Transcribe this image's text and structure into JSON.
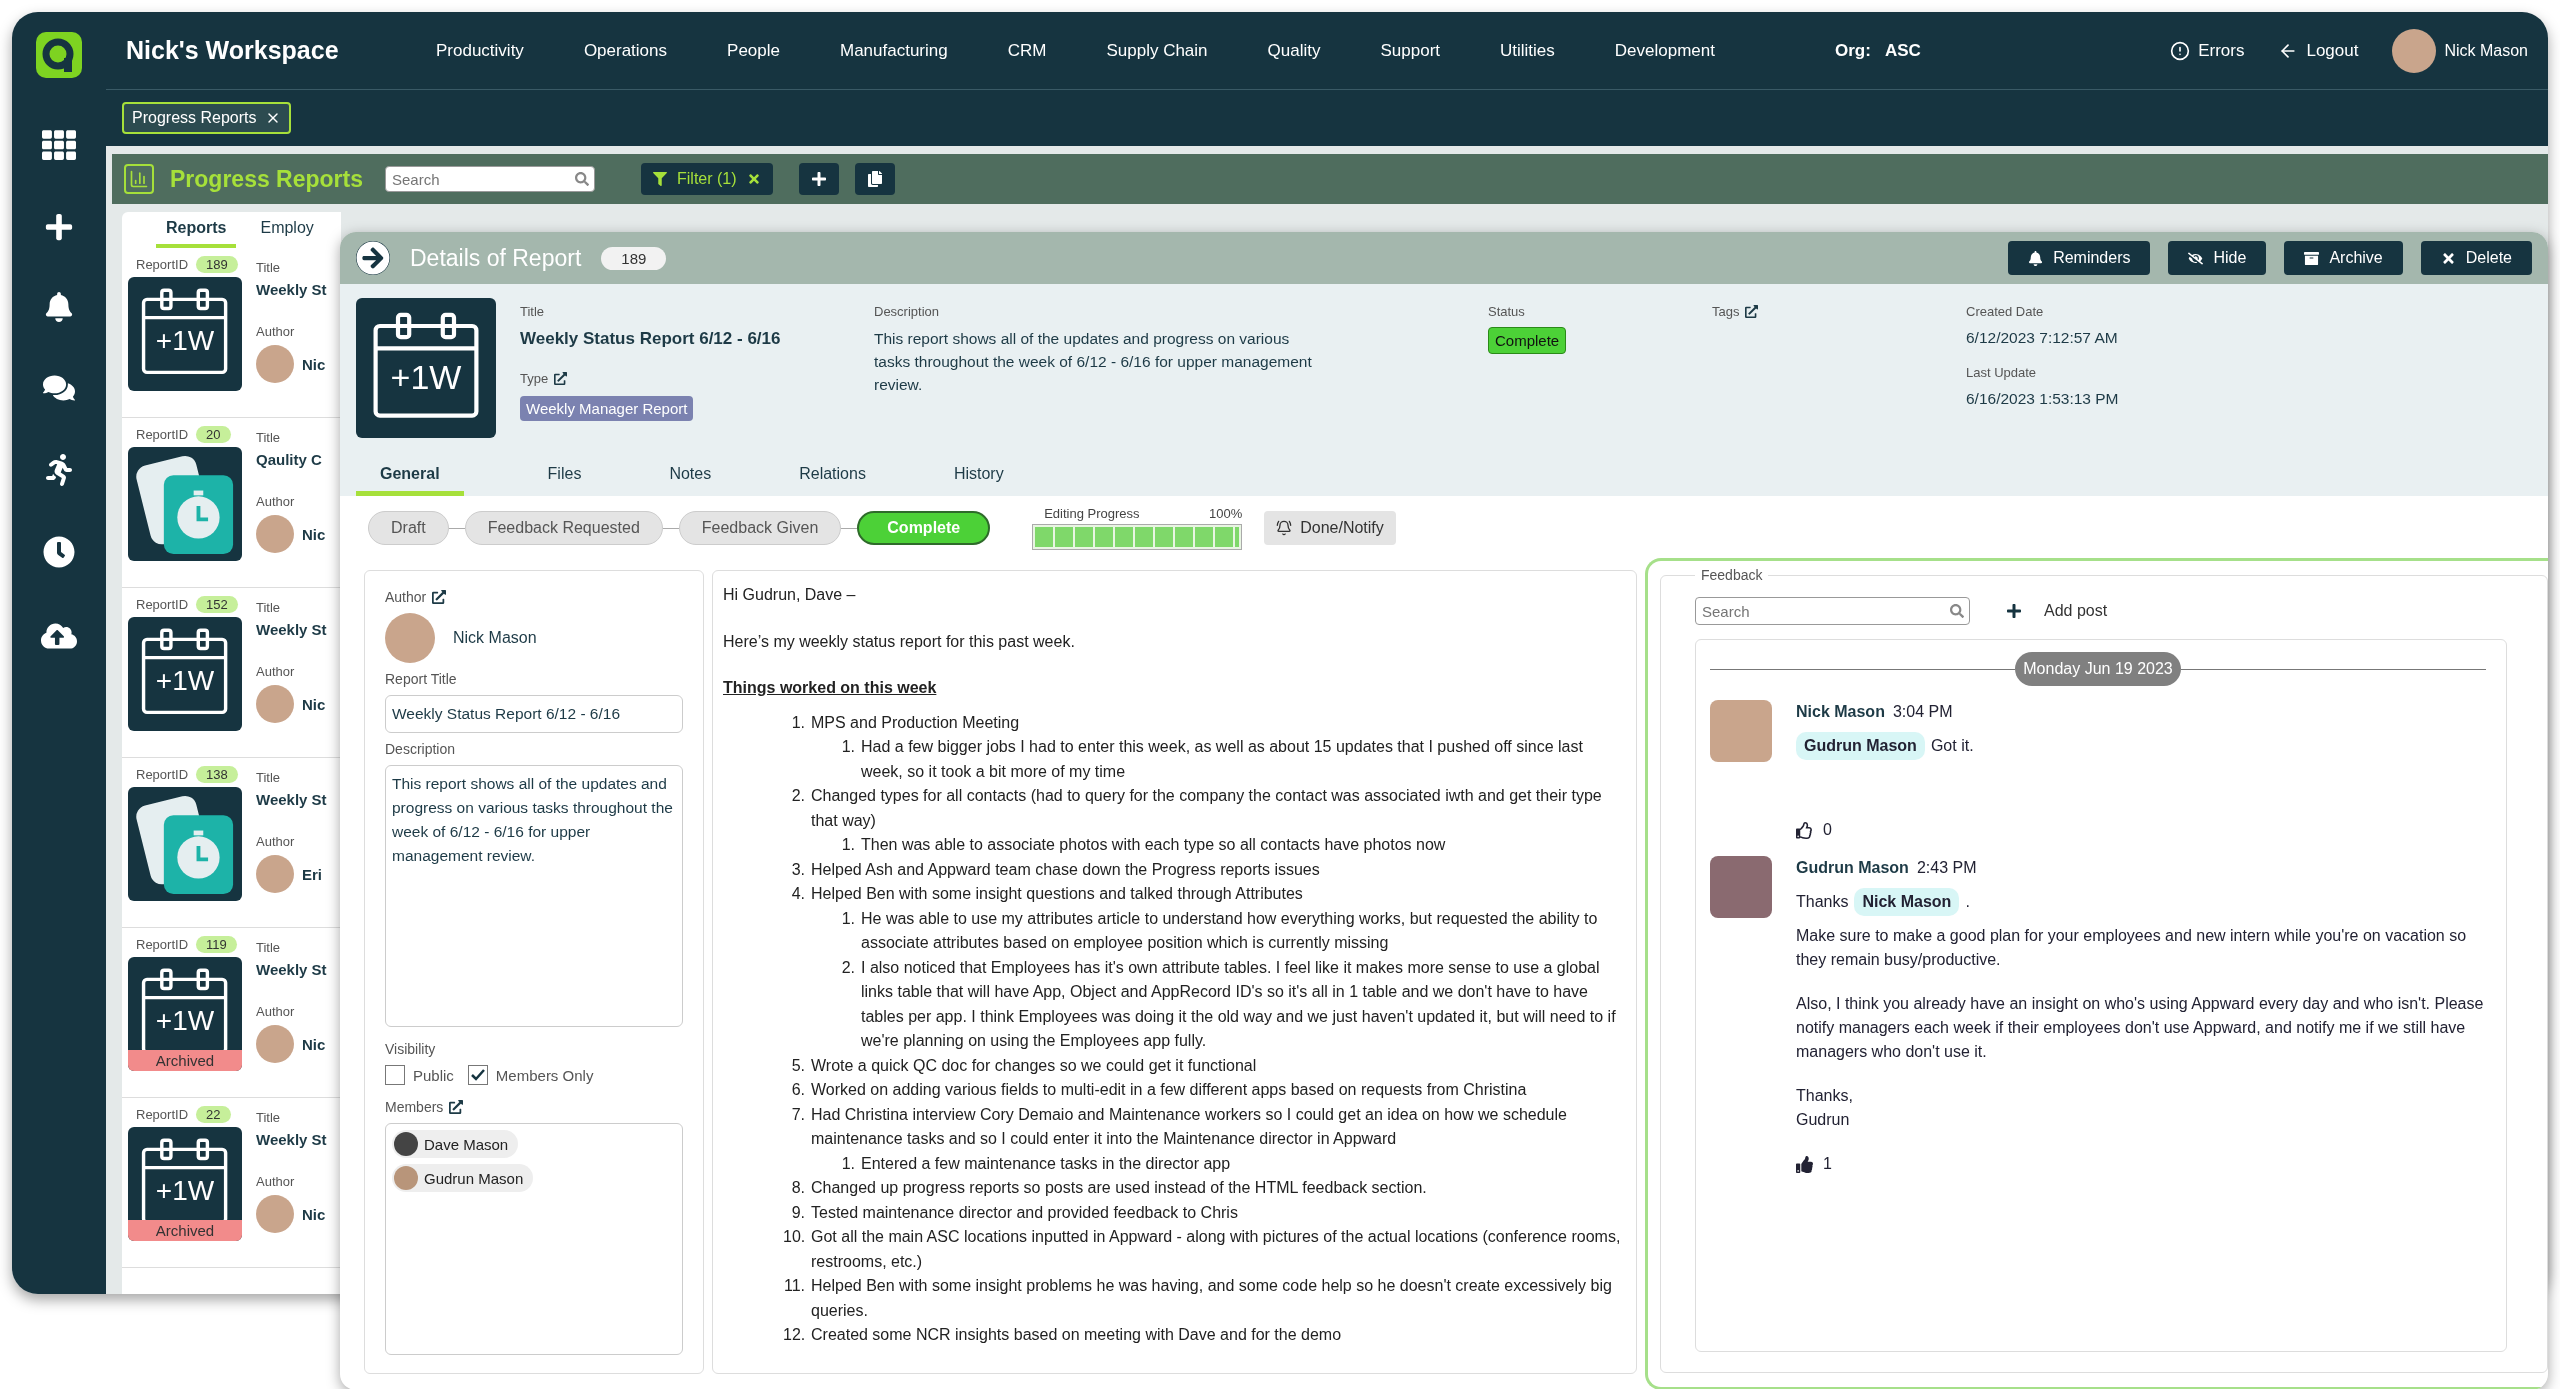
{
  "app": {
    "workspace": "Nick's Workspace",
    "nav": [
      "Productivity",
      "Operations",
      "People",
      "Manufacturing",
      "CRM",
      "Supply Chain",
      "Quality",
      "Support",
      "Utilities",
      "Development"
    ],
    "org_label": "Org:",
    "org": "ASC",
    "errors": "Errors",
    "logout": "Logout",
    "user": "Nick Mason"
  },
  "open_tabs": [
    {
      "label": "Progress Reports"
    }
  ],
  "toolbar": {
    "title": "Progress Reports",
    "search_placeholder": "Search",
    "filter": "Filter (1)"
  },
  "list": {
    "tabs": [
      {
        "label": "Reports",
        "selected": true
      },
      {
        "label": "Employ",
        "selected": false
      }
    ],
    "cards": [
      {
        "id_label": "ReportID",
        "id": "189",
        "title_label": "Title",
        "title": "Weekly St",
        "author_label": "Author",
        "author": "Nic",
        "kind": "calendar",
        "badge": "+1W"
      },
      {
        "id_label": "ReportID",
        "id": "20",
        "title_label": "Title",
        "title": "Qaulity C",
        "author_label": "Author",
        "author": "Nic",
        "kind": "timer"
      },
      {
        "id_label": "ReportID",
        "id": "152",
        "title_label": "Title",
        "title": "Weekly St",
        "author_label": "Author",
        "author": "Nic",
        "kind": "calendar",
        "badge": "+1W"
      },
      {
        "id_label": "ReportID",
        "id": "138",
        "title_label": "Title",
        "title": "Weekly St",
        "author_label": "Author",
        "author": "Eri",
        "kind": "timer"
      },
      {
        "id_label": "ReportID",
        "id": "119",
        "title_label": "Title",
        "title": "Weekly St",
        "author_label": "Author",
        "author": "Nic",
        "kind": "calendar",
        "badge": "+1W",
        "ribbon": "Archived"
      },
      {
        "id_label": "ReportID",
        "id": "22",
        "title_label": "Title",
        "title": "Weekly St",
        "author_label": "Author",
        "author": "Nic",
        "kind": "calendar",
        "badge": "+1W",
        "ribbon": "Archived"
      }
    ]
  },
  "detail": {
    "title": "Details of Report",
    "count": "189",
    "actions": [
      {
        "kind": "reminders",
        "label": "Reminders"
      },
      {
        "kind": "hide",
        "label": "Hide"
      },
      {
        "kind": "archive",
        "label": "Archive"
      },
      {
        "kind": "delete",
        "label": "Delete"
      }
    ],
    "badge": "+1W",
    "title_label": "Title",
    "title_value": "Weekly Status Report 6/12 - 6/16",
    "type_label": "Type",
    "type_value": "Weekly Manager Report",
    "description_label": "Description",
    "description": "This report shows all of the updates and progress on various tasks throughout the week of 6/12 - 6/16 for upper management review.",
    "status_label": "Status",
    "status": "Complete",
    "tags_label": "Tags",
    "created_label": "Created Date",
    "created": "6/12/2023 7:12:57 AM",
    "updated_label": "Last Update",
    "updated": "6/16/2023 1:53:13 PM",
    "tabs": [
      {
        "label": "General",
        "selected": true
      },
      {
        "label": "Files",
        "selected": false
      },
      {
        "label": "Notes",
        "selected": false
      },
      {
        "label": "Relations",
        "selected": false
      },
      {
        "label": "History",
        "selected": false
      }
    ],
    "stages": [
      {
        "label": "Draft",
        "selected": false
      },
      {
        "label": "Feedback Requested",
        "selected": false
      },
      {
        "label": "Feedback Given",
        "selected": false
      },
      {
        "label": "Complete",
        "selected": true
      }
    ],
    "progress": {
      "label": "Editing Progress",
      "reading": "100%",
      "level": 1
    },
    "done_button": "Done/Notify"
  },
  "form": {
    "author_label": "Author",
    "author": "Nick Mason",
    "report_title_label": "Report Title",
    "report_title": "Weekly Status Report 6/12 - 6/16",
    "description_label": "Description",
    "description": "This report shows all of the updates and progress on various tasks throughout the week of 6/12 - 6/16 for upper management review.",
    "visibility_label": "Visibility",
    "options": [
      {
        "label": "Public",
        "checked": false
      },
      {
        "label": "Members Only",
        "checked": true
      }
    ],
    "members_label": "Members",
    "members": [
      "Dave Mason",
      "Gudrun Mason"
    ]
  },
  "body": {
    "greeting": "Hi Gudrun, Dave –",
    "intro": "Here’s my weekly status report for this past week.",
    "heading": "Things worked on this week",
    "items": [
      {
        "number": "1.",
        "text": "MPS and Production Meeting",
        "children": [
          {
            "number": "1.",
            "text": "Had a few bigger jobs I had to enter this week, as well as about 15 updates that I pushed off since last week, so it took a bit more of my time"
          }
        ]
      },
      {
        "number": "2.",
        "text": "Changed types for all contacts (had to query for the company the contact was associated iwth and get their type that way)",
        "children": [
          {
            "number": "1.",
            "text": "Then was able to associate photos with each type so all contacts have photos now"
          }
        ]
      },
      {
        "number": "3.",
        "text": "Helped Ash and Appward team chase down the Progress reports issues"
      },
      {
        "number": "4.",
        "text": "Helped Ben with some insight questions and talked through Attributes",
        "children": [
          {
            "number": "1.",
            "text": "He was able to use my attributes article to understand how everything works, but requested the ability to associate attributes based on employee position which is currently missing"
          },
          {
            "number": "2.",
            "text": "I also noticed that Employees has it's own attribute tables. I feel like it makes more sense to use a global links table that will have App, Object and AppRecord ID's so it's all in 1 table and we don't have to have tables per app. I think Employees was doing it the old way and we just haven't updated it, but will need to if we're planning on using the Employees app fully."
          }
        ]
      },
      {
        "number": "5.",
        "text": "Wrote a quick QC doc for changes so we could get it functional"
      },
      {
        "number": "6.",
        "text": "Worked on adding various fields to multi-edit in a few different apps based on requests from Christina"
      },
      {
        "number": "7.",
        "text": "Had Christina interview Cory Demaio and Maintenance workers so I could get an idea on how we schedule maintenance tasks and so I could enter it into the Maintenance director in Appward",
        "children": [
          {
            "number": "1.",
            "text": "Entered a few maintenance tasks in the director app"
          }
        ]
      },
      {
        "number": "8.",
        "text": "Changed up progress reports so posts are used instead of the HTML feedback section."
      },
      {
        "number": "9.",
        "text": "Tested maintenance director and provided feedback to Chris"
      },
      {
        "number": "10.",
        "text": "Got all the main ASC locations inputted in Appward - along with pictures of the actual locations (conference rooms, restrooms, etc.)"
      },
      {
        "number": "11.",
        "text": "Helped Ben with some insight problems he was having, and some code help so he doesn't create excessively big queries."
      },
      {
        "number": "12.",
        "text": "Created some NCR insights based on meeting with Dave and for the demo"
      }
    ]
  },
  "feedback": {
    "legend": "Feedback",
    "search_placeholder": "Search",
    "add_post": "Add post",
    "date": "Monday Jun 19 2023",
    "posts": [
      {
        "author": "Nick Mason",
        "time": "3:04 PM",
        "line": [
          {
            "kind": "mention",
            "text": "Gudrun Mason"
          },
          {
            "kind": "text",
            "text": "Got it."
          }
        ],
        "likes": "0",
        "liked": false
      },
      {
        "author": "Gudrun Mason",
        "time": "2:43 PM",
        "line": [
          {
            "kind": "text",
            "text": "Thanks"
          },
          {
            "kind": "mention",
            "text": "Nick Mason"
          },
          {
            "kind": "text",
            "text": "."
          }
        ],
        "paragraphs": [
          "Make sure to make a good plan for your employees and new intern while you're on vacation so they remain busy/productive.",
          "Also, I think you already have an insight on who's using Appward every day and who isn't. Please notify managers each week if their employees don't use Appward, and notify me if we still have managers who don't use it.",
          "Thanks,\nGudrun"
        ],
        "likes": "1",
        "liked": true
      }
    ]
  }
}
